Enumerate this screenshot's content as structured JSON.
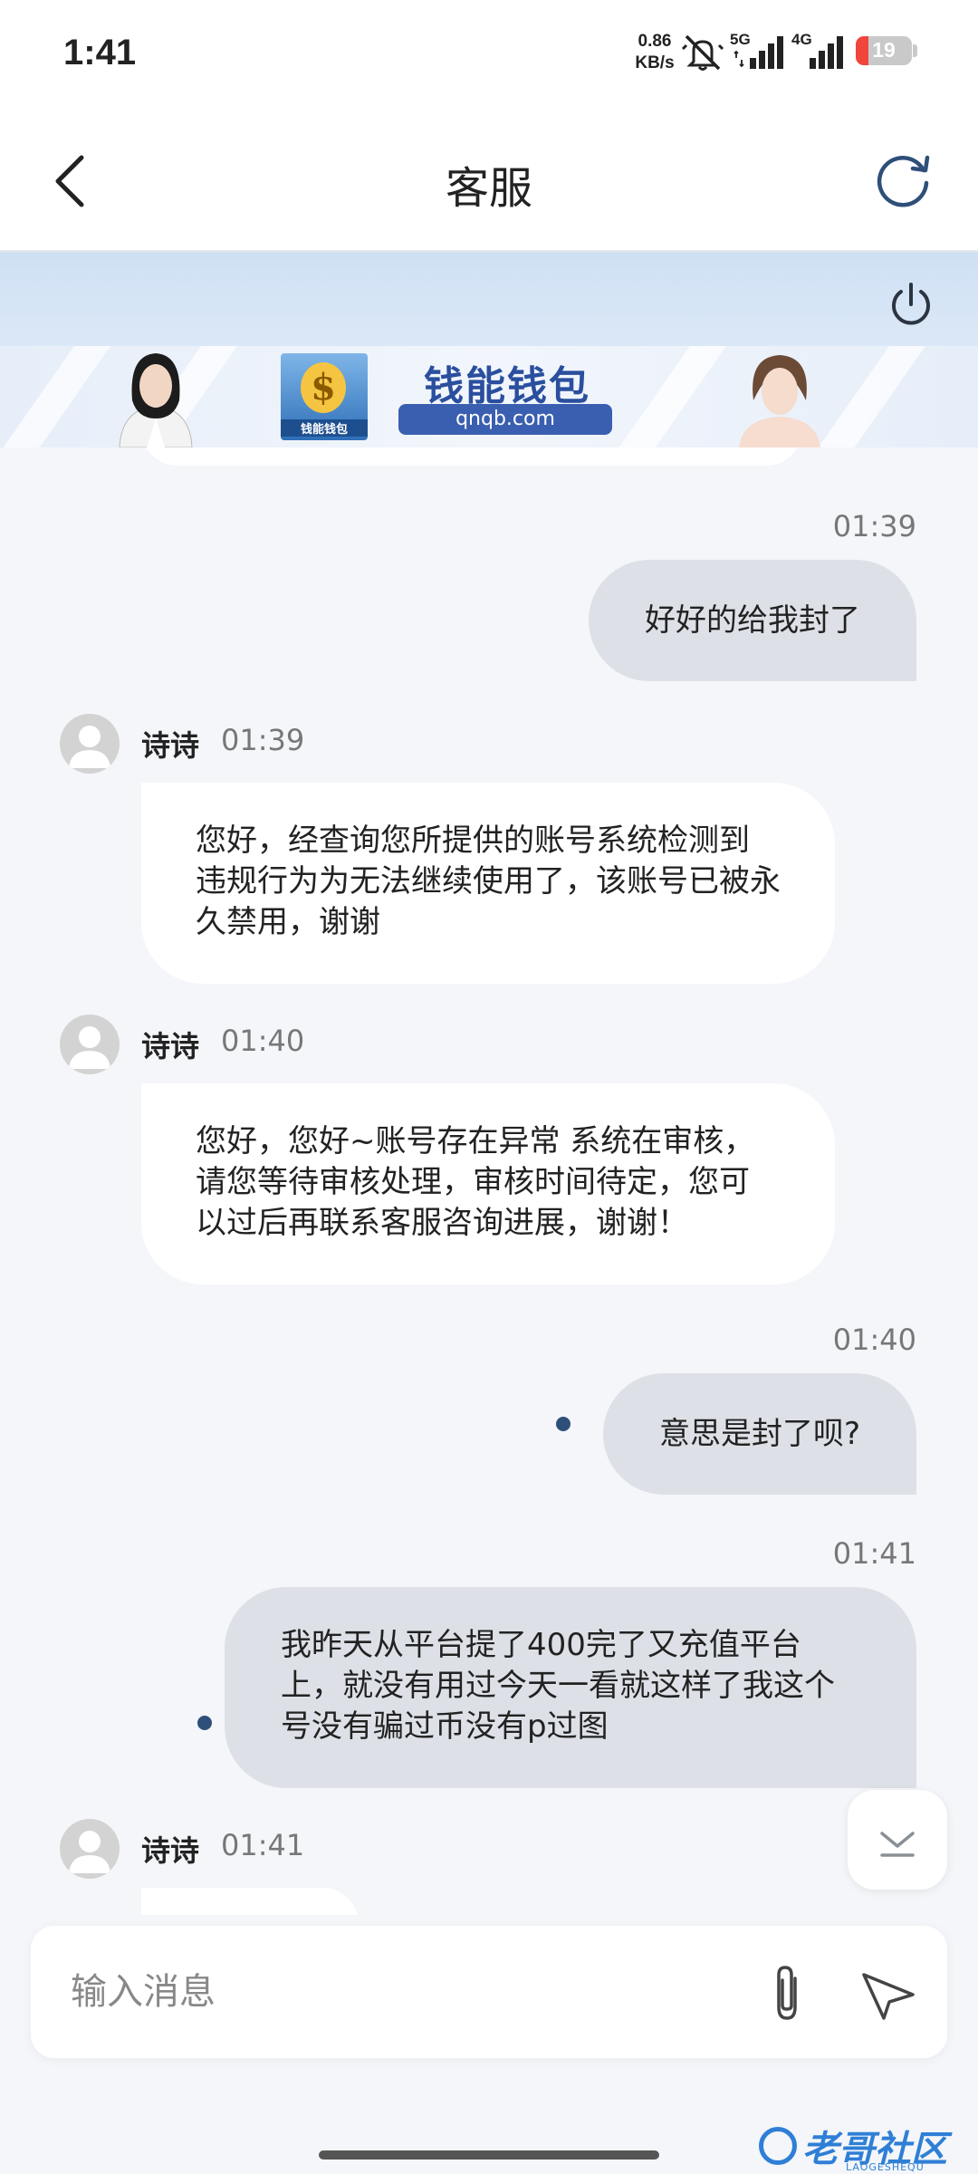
{
  "status_bar": {
    "time": "1:41",
    "net_speed_value": "0.86",
    "net_speed_unit": "KB/s",
    "signal_1_label": "5G",
    "signal_2_label": "4G",
    "battery": "19",
    "icons": [
      "mute-icon",
      "signal-5g-icon",
      "signal-4g-icon",
      "battery-icon"
    ]
  },
  "nav": {
    "title": "客服",
    "back_icon": "chevron-left-icon",
    "refresh_icon": "refresh-icon"
  },
  "banner": {
    "power_icon": "power-icon",
    "brand_name": "钱能钱包",
    "brand_url": "qnqb.com",
    "logo_caption": "钱能钱包"
  },
  "messages": [
    {
      "side": "out",
      "time": "01:39",
      "text": "好好的给我封了"
    },
    {
      "side": "in",
      "name": "诗诗",
      "time": "01:39",
      "lines": [
        "您好，经查询您所提供的账号系统检测到",
        "违规行为为无法继续使用了，该账号已被永",
        "久禁用，谢谢"
      ]
    },
    {
      "side": "in",
      "name": "诗诗",
      "time": "01:40",
      "lines": [
        "您好，您好~账号存在异常 系统在审核，",
        "请您等待审核处理，审核时间待定，您可",
        "以过后再联系客服咨询进展，谢谢！"
      ]
    },
    {
      "side": "out",
      "time": "01:40",
      "text": "意思是封了呗?"
    },
    {
      "side": "out",
      "time": "01:41",
      "lines": [
        "我昨天从平台提了400完了又充值平台",
        "上，就没有用过今天一看就这样了我这个",
        "号没有骗过币没有p过图"
      ]
    },
    {
      "side": "in",
      "name": "诗诗",
      "time": "01:41"
    }
  ],
  "input": {
    "placeholder": "输入消息",
    "attach_icon": "paperclip-icon",
    "send_icon": "send-icon"
  },
  "scroll_down_icon": "chevron-down-icon",
  "watermark": "老哥社区",
  "watermark_sub": "LAOGESHEQU"
}
